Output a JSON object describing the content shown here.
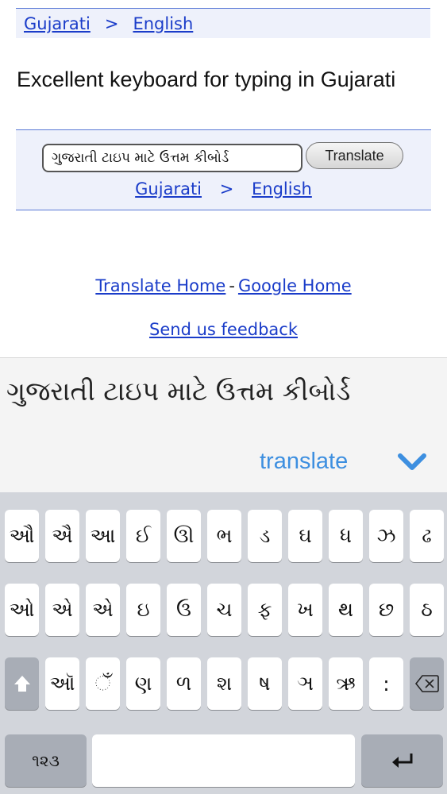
{
  "lang_bar_top": {
    "source": "Gujarati",
    "separator": ">",
    "target": "English"
  },
  "page_title": "Excellent keyboard for typing in Gujarati",
  "translate_box": {
    "input_value": "ગુજરાતી ટાઇપ માટે ઉત્તમ કીબોર્ડ",
    "button_label": "Translate",
    "source": "Gujarati",
    "separator": ">",
    "target": "English"
  },
  "footer": {
    "translate_home": "Translate Home",
    "dash": "-",
    "google_home": "Google Home",
    "feedback": "Send us feedback"
  },
  "overlay": {
    "text": "ગુજરાતી ટાઇપ માટે ઉત્તમ કીબોર્ડ",
    "translate_label": "translate",
    "accent_color": "#3d8fe0"
  },
  "keyboard": {
    "row1": [
      "ઔ",
      "ઐ",
      "આ",
      "ઈ",
      "ઊ",
      "ભ",
      "ડ",
      "ઘ",
      "ધ",
      "ઝ",
      "ઢ"
    ],
    "row2": [
      "ઓ",
      "એ",
      "એ",
      "ઇ",
      "ઉ",
      "ચ",
      "ફ",
      "ખ",
      "થ",
      "છ",
      "ઠ"
    ],
    "row3": [
      "ઑ",
      "ઁ",
      "ણ",
      "ળ",
      "શ",
      "ષ",
      "ઞ",
      "ઋ",
      ":"
    ],
    "numbers_label": "૧૨૩",
    "shift_icon": "shift-arrow-icon",
    "delete_icon": "backspace-icon",
    "return_icon": "return-arrow-icon"
  }
}
